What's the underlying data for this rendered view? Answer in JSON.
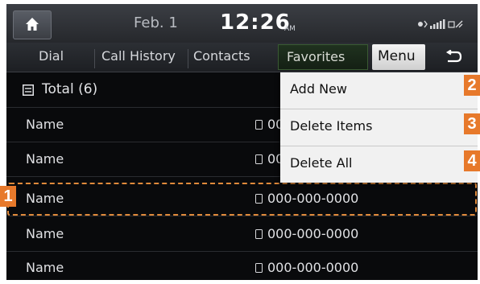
{
  "status": {
    "date": "Feb. 1",
    "time": "12:26",
    "ampm": "AM"
  },
  "tabs": {
    "dial": "Dial",
    "call_history": "Call History",
    "contacts": "Contacts",
    "favorites": "Favorites",
    "menu": "Menu"
  },
  "list": {
    "total_label": "Total (6)",
    "rows": [
      {
        "name": "Name",
        "number": "000-000-0000"
      },
      {
        "name": "Name",
        "number": "000-000-0000"
      },
      {
        "name": "Name",
        "number": "000-000-0000"
      },
      {
        "name": "Name",
        "number": "000-000-0000"
      },
      {
        "name": "Name",
        "number": "000-000-0000"
      }
    ]
  },
  "menu": {
    "items": [
      "Add New",
      "Delete Items",
      "Delete All"
    ]
  },
  "callouts": [
    "1",
    "2",
    "3",
    "4"
  ],
  "colors": {
    "background": "#090a0c",
    "accent_orange": "#e7792b",
    "active_tab": "#1a2a19",
    "menu_panel": "#f1f1f1"
  }
}
